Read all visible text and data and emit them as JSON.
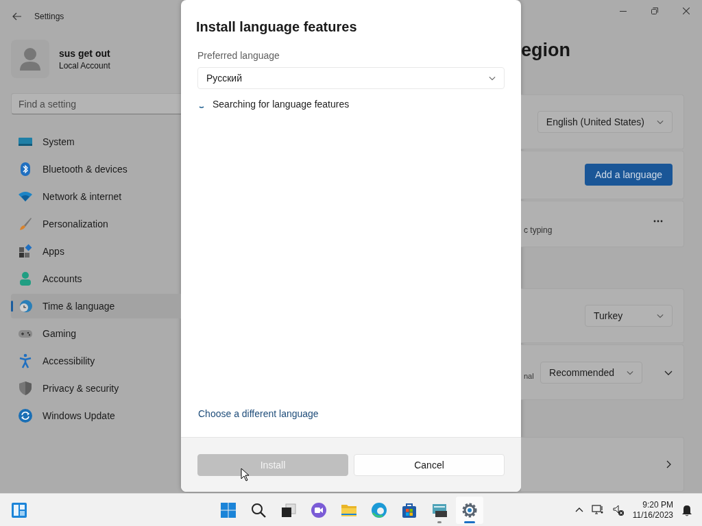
{
  "window": {
    "title": "Settings"
  },
  "account": {
    "name": "sus get out",
    "type": "Local Account"
  },
  "search": {
    "placeholder": "Find a setting"
  },
  "nav": {
    "items": [
      {
        "label": "System",
        "selected": false
      },
      {
        "label": "Bluetooth & devices",
        "selected": false
      },
      {
        "label": "Network & internet",
        "selected": false
      },
      {
        "label": "Personalization",
        "selected": false
      },
      {
        "label": "Apps",
        "selected": false
      },
      {
        "label": "Accounts",
        "selected": false
      },
      {
        "label": "Time & language",
        "selected": true
      },
      {
        "label": "Gaming",
        "selected": false
      },
      {
        "label": "Accessibility",
        "selected": false
      },
      {
        "label": "Privacy & security",
        "selected": false
      },
      {
        "label": "Windows Update",
        "selected": false
      }
    ]
  },
  "content": {
    "title": "egion",
    "cards": [
      {
        "kind": "dropdown",
        "value": "English (United States)"
      },
      {
        "kind": "button",
        "label": "Add a language"
      },
      {
        "kind": "more",
        "text": "c typing"
      },
      {
        "kind": "gap"
      },
      {
        "kind": "dropdown",
        "value": "Turkey"
      },
      {
        "kind": "expand",
        "text": "nal",
        "value": "Recommended"
      },
      {
        "kind": "gap"
      },
      {
        "kind": "link"
      }
    ]
  },
  "dialog": {
    "title": "Install language features",
    "label": "Preferred language",
    "value": "Русский",
    "status": "Searching for language features",
    "link": "Choose a different language",
    "buttons": [
      {
        "label": "Install",
        "disabled": true
      },
      {
        "label": "Cancel",
        "disabled": false
      }
    ]
  },
  "taskbar": {
    "apps": [
      {
        "kind": "start",
        "running": false,
        "selected": false
      },
      {
        "kind": "search",
        "running": false,
        "selected": false
      },
      {
        "kind": "taskview",
        "running": false,
        "selected": false
      },
      {
        "kind": "chat",
        "running": false,
        "selected": false
      },
      {
        "kind": "explorer",
        "running": false,
        "selected": false
      },
      {
        "kind": "edge",
        "running": false,
        "selected": false
      },
      {
        "kind": "store",
        "running": false,
        "selected": false
      },
      {
        "kind": "terminal",
        "running": true,
        "selected": false
      },
      {
        "kind": "settings",
        "running": true,
        "selected": true
      }
    ],
    "time": "9:20 PM",
    "date": "11/16/2023"
  }
}
